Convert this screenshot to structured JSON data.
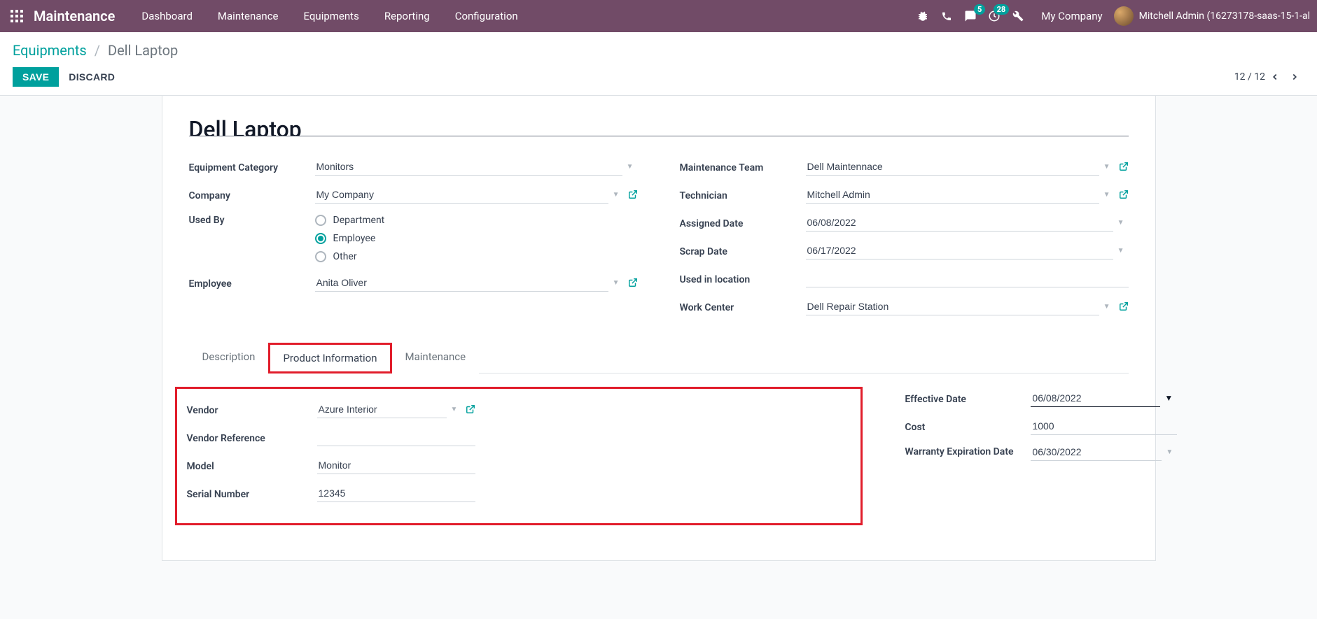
{
  "nav": {
    "brand": "Maintenance",
    "links": [
      "Dashboard",
      "Maintenance",
      "Equipments",
      "Reporting",
      "Configuration"
    ],
    "msg_badge": "5",
    "activity_badge": "28",
    "company": "My Company",
    "user": "Mitchell Admin (16273178-saas-15-1-al"
  },
  "breadcrumb": {
    "root": "Equipments",
    "current": "Dell Laptop"
  },
  "actions": {
    "save": "SAVE",
    "discard": "DISCARD"
  },
  "pager": {
    "text": "12 / 12"
  },
  "title": "Dell Laptop",
  "left": {
    "category_label": "Equipment Category",
    "category": "Monitors",
    "company_label": "Company",
    "company": "My Company",
    "used_by_label": "Used By",
    "used_by_options": [
      "Department",
      "Employee",
      "Other"
    ],
    "used_by_selected": "Employee",
    "employee_label": "Employee",
    "employee": "Anita Oliver"
  },
  "right": {
    "team_label": "Maintenance Team",
    "team": "Dell Maintennace",
    "tech_label": "Technician",
    "tech": "Mitchell Admin",
    "assigned_label": "Assigned Date",
    "assigned": "06/08/2022",
    "scrap_label": "Scrap Date",
    "scrap": "06/17/2022",
    "location_label": "Used in location",
    "location": "",
    "workcenter_label": "Work Center",
    "workcenter": "Dell Repair Station"
  },
  "tabs": {
    "desc": "Description",
    "product": "Product Information",
    "maint": "Maintenance"
  },
  "product": {
    "vendor_label": "Vendor",
    "vendor": "Azure Interior",
    "vendor_ref_label": "Vendor Reference",
    "vendor_ref": "",
    "model_label": "Model",
    "model": "Monitor",
    "serial_label": "Serial Number",
    "serial": "12345",
    "effective_label": "Effective Date",
    "effective": "06/08/2022",
    "cost_label": "Cost",
    "cost": "1000",
    "warranty_label": "Warranty Expiration Date",
    "warranty": "06/30/2022"
  }
}
